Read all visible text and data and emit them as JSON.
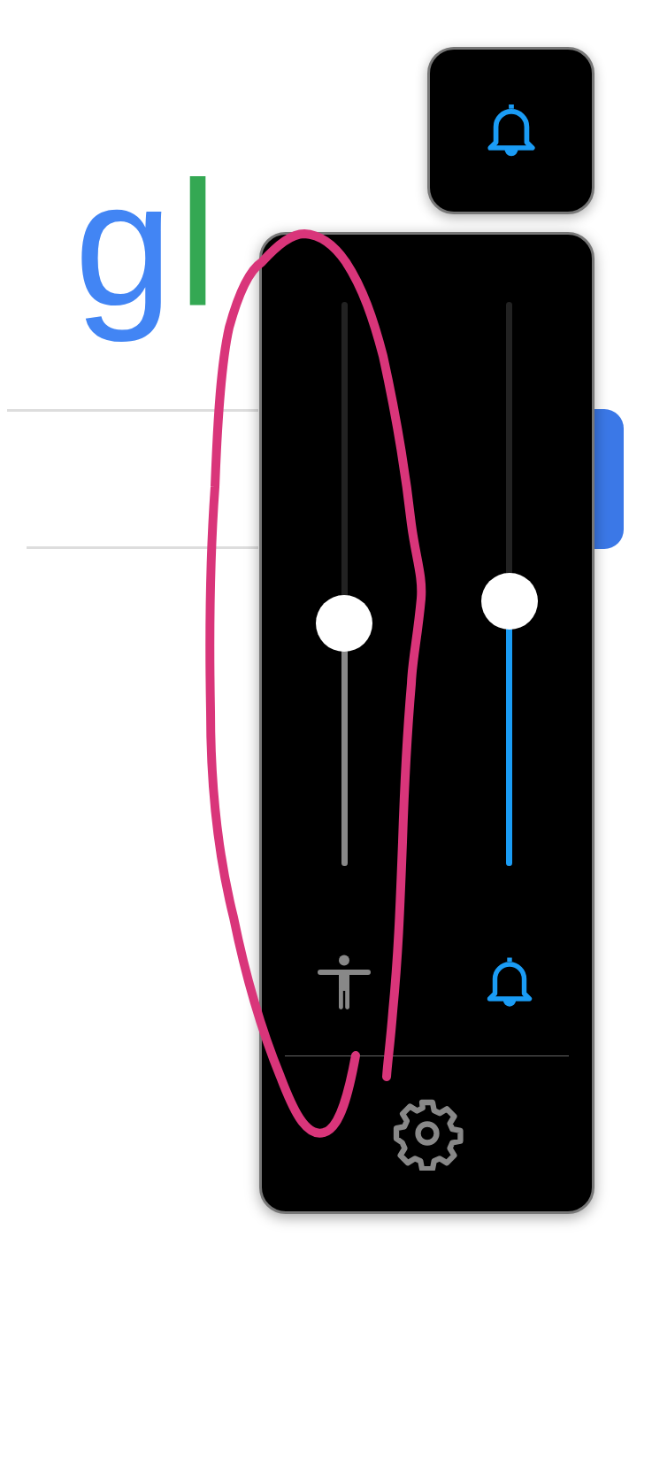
{
  "background": {
    "logo": [
      {
        "text": "g",
        "color": "#4285f4"
      },
      {
        "text": "l",
        "color": "#34a853"
      }
    ]
  },
  "volume_panel": {
    "sliders": [
      {
        "kind": "accessibility",
        "level": 0.43,
        "active": false
      },
      {
        "kind": "ring",
        "level": 0.47,
        "active": true
      }
    ]
  }
}
